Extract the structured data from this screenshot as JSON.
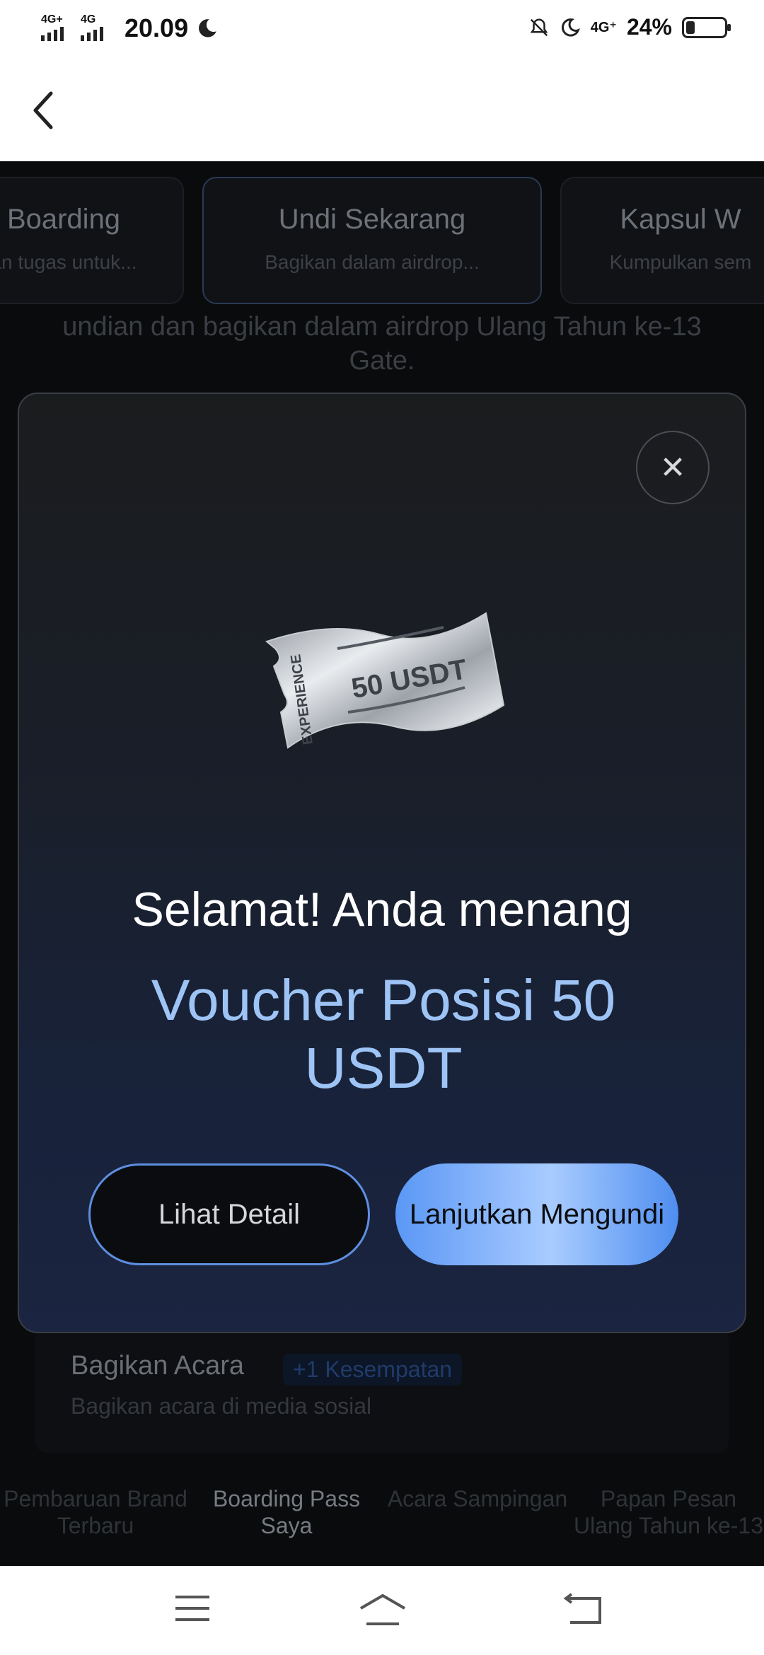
{
  "status_bar": {
    "network1": "4G+",
    "network2": "4G",
    "time": "20.09",
    "right_network": "4G⁺",
    "battery": "24%",
    "battery_level": 0.24
  },
  "background": {
    "tabs": [
      {
        "title": "Boarding",
        "subtitle": "an tugas untuk..."
      },
      {
        "title": "Undi Sekarang",
        "subtitle": "Bagikan dalam airdrop..."
      },
      {
        "title": "Kapsul W",
        "subtitle": "Kumpulkan sem"
      }
    ],
    "intro_text": "undian dan bagikan dalam airdrop Ulang Tahun ke-13 Gate.",
    "share": {
      "title": "Bagikan Acara",
      "chip": "+1 Kesempatan",
      "subtitle": "Bagikan acara di media sosial"
    },
    "bottom_nav": [
      "Pembaruan Brand Terbaru",
      "Boarding Pass Saya",
      "Acara Sampingan",
      "Papan Pesan Ulang Tahun ke-13"
    ]
  },
  "modal": {
    "close_icon": "close-icon",
    "ticket_value": "50 USDT",
    "ticket_side": "EXPERIENCE",
    "title": "Selamat! Anda menang",
    "prize": "Voucher Posisi 50 USDT",
    "detail_button": "Lihat Detail",
    "continue_button": "Lanjutkan Mengundi"
  },
  "colors": {
    "accent_blue": "#9ec4f6",
    "button_blue": "#5a97f5"
  }
}
